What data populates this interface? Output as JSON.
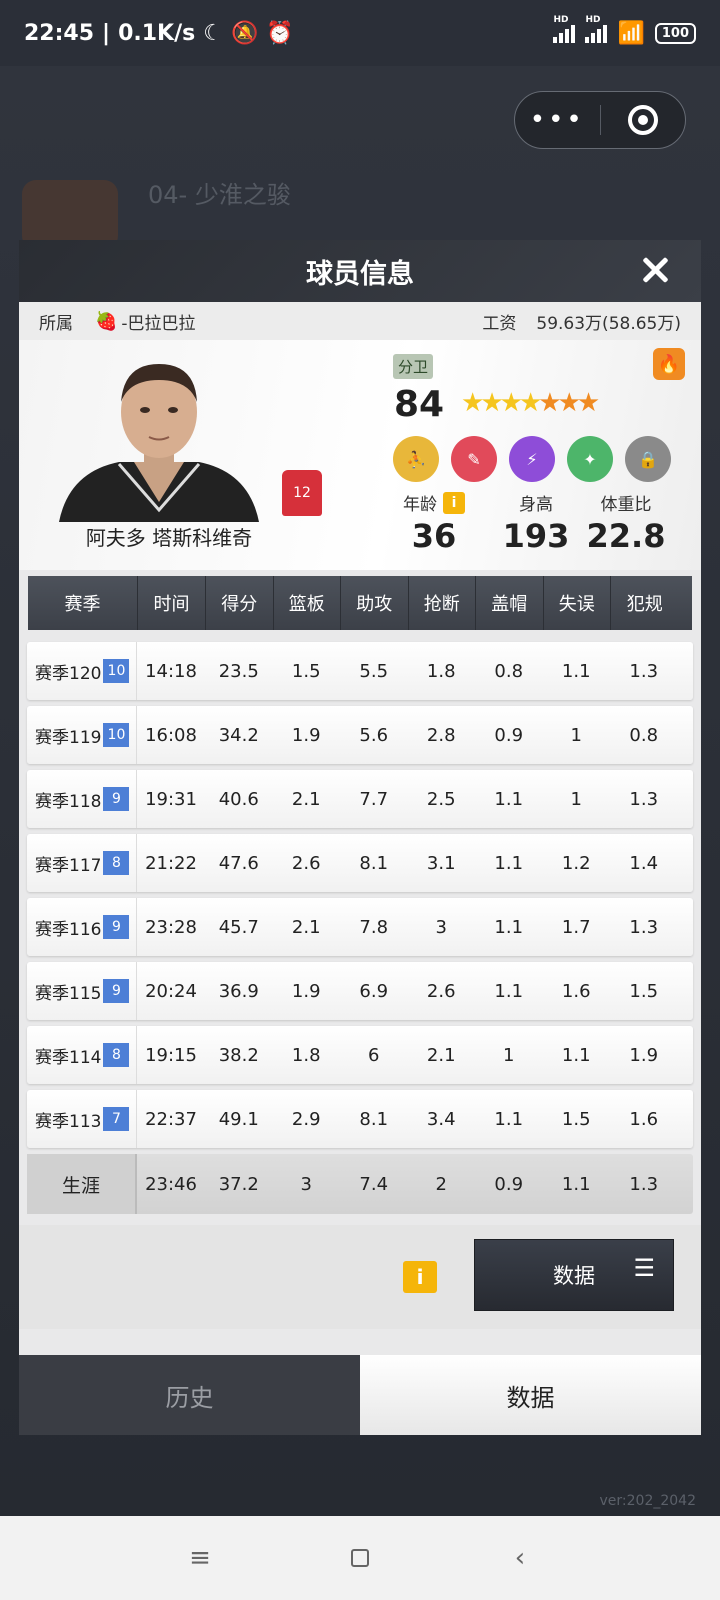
{
  "status_bar": {
    "time": "22:45",
    "network_speed": "0.1K/s",
    "battery": "100",
    "hd_label": "HD"
  },
  "background": {
    "title": "04- 少淮之骏",
    "version": "ver:202_2042"
  },
  "modal": {
    "title": "球员信息",
    "affiliation_label": "所属",
    "team_name": "-巴拉巴拉",
    "salary_label": "工资",
    "salary_value": "59.63万(58.65万)"
  },
  "player": {
    "name": "阿夫多 塔斯科维奇",
    "jersey_number": "12",
    "position": "分卫",
    "rating": "84",
    "stars_gold": 4,
    "stars_orange": 3,
    "age_label": "年龄",
    "age": "36",
    "height_label": "身高",
    "height": "193",
    "weight_ratio_label": "体重比",
    "weight_ratio": "22.8"
  },
  "table": {
    "headers": [
      "赛季",
      "时间",
      "得分",
      "篮板",
      "助攻",
      "抢断",
      "盖帽",
      "失误",
      "犯规"
    ],
    "rows": [
      {
        "season": "赛季120",
        "level": "10",
        "time": "14:18",
        "pts": "23.5",
        "reb": "1.5",
        "ast": "5.5",
        "stl": "1.8",
        "blk": "0.8",
        "tov": "1.1",
        "pf": "1.3"
      },
      {
        "season": "赛季119",
        "level": "10",
        "time": "16:08",
        "pts": "34.2",
        "reb": "1.9",
        "ast": "5.6",
        "stl": "2.8",
        "blk": "0.9",
        "tov": "1",
        "pf": "0.8"
      },
      {
        "season": "赛季118",
        "level": "9",
        "time": "19:31",
        "pts": "40.6",
        "reb": "2.1",
        "ast": "7.7",
        "stl": "2.5",
        "blk": "1.1",
        "tov": "1",
        "pf": "1.3"
      },
      {
        "season": "赛季117",
        "level": "8",
        "time": "21:22",
        "pts": "47.6",
        "reb": "2.6",
        "ast": "8.1",
        "stl": "3.1",
        "blk": "1.1",
        "tov": "1.2",
        "pf": "1.4"
      },
      {
        "season": "赛季116",
        "level": "9",
        "time": "23:28",
        "pts": "45.7",
        "reb": "2.1",
        "ast": "7.8",
        "stl": "3",
        "blk": "1.1",
        "tov": "1.7",
        "pf": "1.3"
      },
      {
        "season": "赛季115",
        "level": "9",
        "time": "20:24",
        "pts": "36.9",
        "reb": "1.9",
        "ast": "6.9",
        "stl": "2.6",
        "blk": "1.1",
        "tov": "1.6",
        "pf": "1.5"
      },
      {
        "season": "赛季114",
        "level": "8",
        "time": "19:15",
        "pts": "38.2",
        "reb": "1.8",
        "ast": "6",
        "stl": "2.1",
        "blk": "1",
        "tov": "1.1",
        "pf": "1.9"
      },
      {
        "season": "赛季113",
        "level": "7",
        "time": "22:37",
        "pts": "49.1",
        "reb": "2.9",
        "ast": "8.1",
        "stl": "3.4",
        "blk": "1.1",
        "tov": "1.5",
        "pf": "1.6"
      }
    ],
    "career": {
      "label": "生涯",
      "time": "23:46",
      "pts": "37.2",
      "reb": "3",
      "ast": "7.4",
      "stl": "2",
      "blk": "0.9",
      "tov": "1.1",
      "pf": "1.3"
    }
  },
  "footer": {
    "info_label": "i",
    "data_button_label": "数据"
  },
  "tabs": [
    {
      "label": "历史"
    },
    {
      "label": "数据"
    }
  ],
  "colors": {
    "level_badge": "#4d7fd6",
    "info_yellow": "#f5b50a",
    "header_dark": "#3c4048"
  }
}
